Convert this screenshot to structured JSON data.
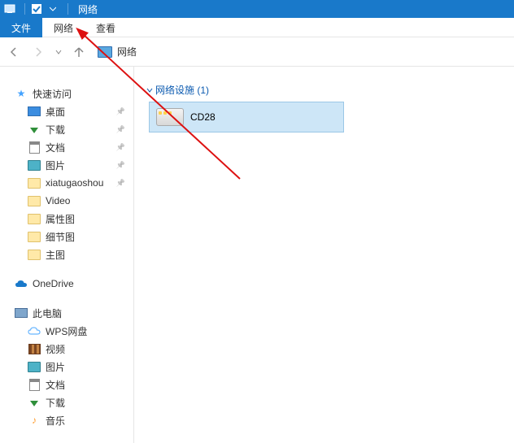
{
  "titlebar": {
    "title": "网络"
  },
  "ribbon": {
    "file": "文件",
    "network": "网络",
    "view": "查看"
  },
  "breadcrumb": {
    "root": "网络"
  },
  "sidebar": {
    "quickaccess": {
      "header": "快速访问",
      "items": [
        {
          "label": "桌面",
          "icon": "desktop",
          "pin": true
        },
        {
          "label": "下载",
          "icon": "dl",
          "pin": true
        },
        {
          "label": "文档",
          "icon": "doc",
          "pin": true
        },
        {
          "label": "图片",
          "icon": "pic",
          "pin": true
        },
        {
          "label": "xiatugaoshou",
          "icon": "folder-dim",
          "pin": true
        },
        {
          "label": "Video",
          "icon": "folder-dim",
          "pin": false
        },
        {
          "label": "属性图",
          "icon": "folder-dim",
          "pin": false
        },
        {
          "label": "细节图",
          "icon": "folder-dim",
          "pin": false
        },
        {
          "label": "主图",
          "icon": "folder-dim",
          "pin": false
        }
      ]
    },
    "onedrive": {
      "label": "OneDrive"
    },
    "thispc": {
      "header": "此电脑",
      "items": [
        {
          "label": "WPS网盘",
          "icon": "wps"
        },
        {
          "label": "视频",
          "icon": "film"
        },
        {
          "label": "图片",
          "icon": "pic"
        },
        {
          "label": "文档",
          "icon": "doc"
        },
        {
          "label": "下载",
          "icon": "dl"
        },
        {
          "label": "音乐",
          "icon": "music"
        }
      ]
    }
  },
  "content": {
    "category": "网络设施 (1)",
    "device": "CD28"
  }
}
